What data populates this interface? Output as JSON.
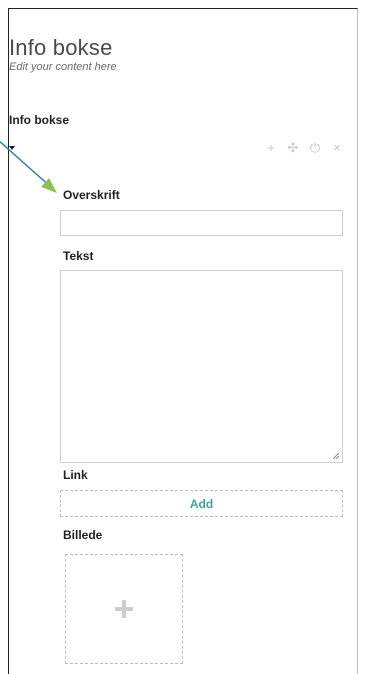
{
  "header": {
    "title": "Info bokse",
    "subtitle": "Edit your content here"
  },
  "block": {
    "label": "Info bokse",
    "actions": [
      {
        "icon": "plus-icon",
        "glyph": "+"
      },
      {
        "icon": "move-icon",
        "glyph": "✣"
      },
      {
        "icon": "power-icon",
        "glyph": "⏻"
      },
      {
        "icon": "close-icon",
        "glyph": "×"
      }
    ]
  },
  "fields": {
    "headline": {
      "label": "Overskrift",
      "value": "",
      "placeholder": ""
    },
    "text": {
      "label": "Tekst",
      "value": "",
      "placeholder": ""
    },
    "link": {
      "label": "Link",
      "add_label": "Add"
    },
    "image": {
      "label": "Billede"
    }
  },
  "colors": {
    "accent": "#3aa79a",
    "annotation_arrow": "#8bc34a"
  }
}
